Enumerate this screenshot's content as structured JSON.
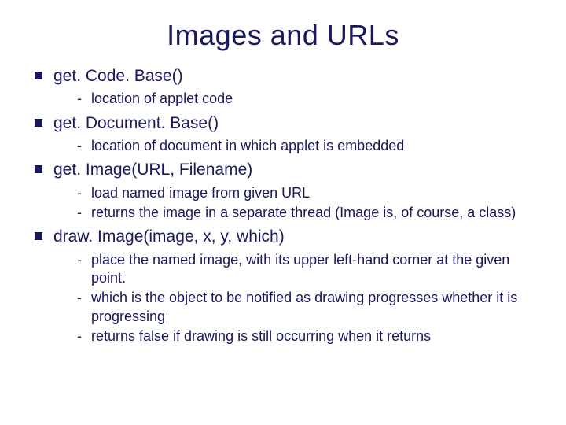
{
  "title": "Images and URLs",
  "items": [
    {
      "text": "get. Code. Base()",
      "sub": [
        "location of applet code"
      ]
    },
    {
      "text": "get. Document. Base()",
      "sub": [
        "location of document in which applet is embedded"
      ]
    },
    {
      "text": "get. Image(URL, Filename)",
      "sub": [
        "load named image from given URL",
        "returns the image in a separate thread (Image is, of course, a class)"
      ]
    },
    {
      "text": "draw. Image(image, x, y, which)",
      "sub": [
        "place the named image, with its upper left-hand corner at the given point.",
        "which is the object to be notified as drawing progresses whether it is progressing",
        "returns false if drawing is still occurring when it returns"
      ]
    }
  ]
}
